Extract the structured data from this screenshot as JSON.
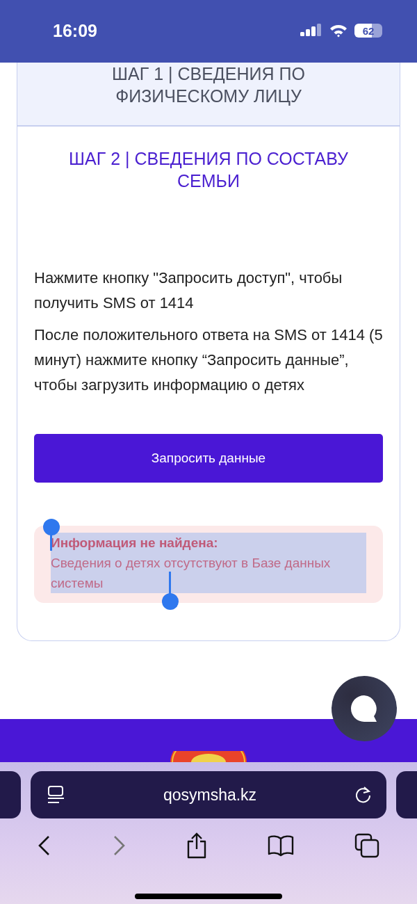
{
  "status_bar": {
    "time": "16:09",
    "battery": "62"
  },
  "steps": [
    {
      "title": "ШАГ 1 | СВЕДЕНИЯ ПО ФИЗИЧЕСКОМУ ЛИЦУ",
      "selected": false
    },
    {
      "title": "ШАГ 2 | СВЕДЕНИЯ ПО СОСТАВУ СЕМЬИ",
      "selected": true
    }
  ],
  "instructions": [
    "Нажмите кнопку \"Запросить доступ\", чтобы получить SMS от 1414",
    "После положительного ответа на SMS от 1414 (5 минут) нажмите кнопку “Запросить данные”, чтобы загрузить информацию о детях"
  ],
  "button": "Запросить данные",
  "alert": {
    "title": "Информация не найдена:",
    "message": "Сведения о детях отсутствуют в Базе данных системы",
    "selected": true
  },
  "browser": {
    "url": "qosymsha.kz"
  }
}
